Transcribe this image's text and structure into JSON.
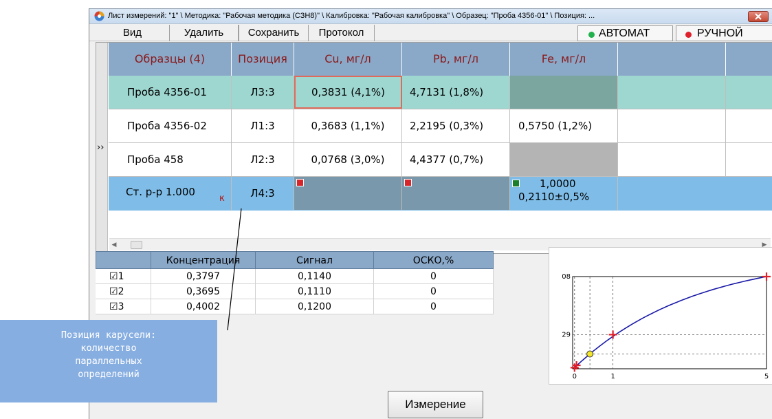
{
  "window": {
    "title": "Лист измерений: \"1\" \\ Методика: \"Рабочая методика (СЗН8)\" \\ Калибровка: \"Рабочая калибровка\" \\ Образец: \"Проба 4356-01\" \\ Позиция: ..."
  },
  "toolbar": {
    "view": "Вид",
    "delete": "Удалить",
    "save": "Сохранить",
    "protocol": "Протокол",
    "auto": "АВТОМАТ",
    "manual": "РУЧНОЙ"
  },
  "colors": {
    "auto_dot": "#22b14c",
    "manual_dot": "#e0202a",
    "header_bg": "#8aa8c8",
    "selected_row": "#7fbde8",
    "first_row": "#9ed6d0"
  },
  "grid": {
    "expander": "››",
    "headers": [
      "Образцы (4)",
      "Позиция",
      "Cu, мг/л",
      "Pb, мг/л",
      "Fe, мг/л"
    ],
    "rows": [
      {
        "sample": "Проба 4356-01",
        "pos": "Л3:3",
        "cu": "0,3831 (4,1%)",
        "pb": "4,7131 (1,8%)",
        "fe": ""
      },
      {
        "sample": "Проба 4356-02",
        "pos": "Л1:3",
        "cu": "0,3683 (1,1%)",
        "pb": "2,2195 (0,3%)",
        "fe": "0,5750 (1,2%)"
      },
      {
        "sample": "Проба 458",
        "pos": "Л2:3",
        "cu": "0,0768 (3,0%)",
        "pb": "4,4377 (0,7%)",
        "fe": ""
      },
      {
        "sample": "Ст. р-р 1.000",
        "mark": "к",
        "pos": "Л4:3",
        "cu": "",
        "pb": "",
        "fe_line1": "1,0000",
        "fe_line2": "0,2110±0,5%"
      }
    ]
  },
  "calib": {
    "headers": [
      "Концентрация",
      "Сигнал",
      "ОСКО,%"
    ],
    "rows": [
      {
        "check": "☑",
        "n": "1",
        "conc": "0,3797",
        "signal": "0,1140",
        "osko": "0"
      },
      {
        "check": "☑",
        "n": "2",
        "conc": "0,3695",
        "signal": "0,1110",
        "osko": "0"
      },
      {
        "check": "☑",
        "n": "3",
        "conc": "0,4002",
        "signal": "0,1200",
        "osko": "0"
      }
    ]
  },
  "chart_data": {
    "type": "scatter",
    "series": [
      {
        "points_x": [
          0,
          0.05,
          0.4,
          1,
          5
        ],
        "points_y": [
          0,
          0.02,
          0.12,
          0.29,
          0.8
        ]
      }
    ],
    "tick_x": [
      "0",
      "1",
      "5"
    ],
    "tick_y": [
      "08",
      "29",
      ""
    ]
  },
  "annotation": {
    "lines": [
      "Позиция карусели:",
      "количество",
      "параллельных",
      "определений"
    ]
  },
  "measure_button": "Измерение"
}
